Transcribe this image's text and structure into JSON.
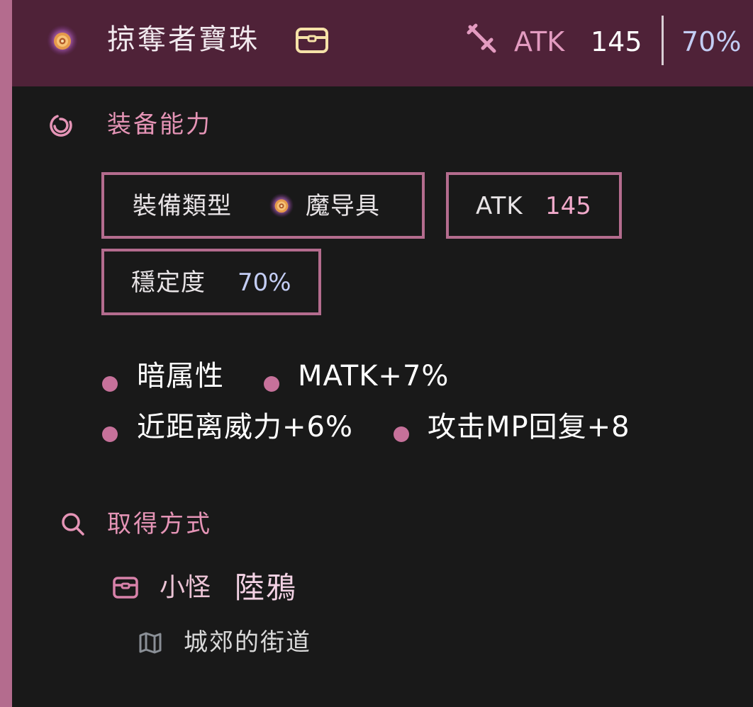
{
  "header": {
    "item_name": "掠奪者寶珠",
    "atk_label": "ATK",
    "atk_value": "145",
    "stability": "70%"
  },
  "equipment_section": {
    "title": "装备能力",
    "type_label": "裝備類型",
    "type_value": "魔导具",
    "atk_label": "ATK",
    "atk_value": "145",
    "stability_label": "穩定度",
    "stability_value": "70%"
  },
  "abilities": [
    "暗属性",
    "MATK+7%",
    "近距离威力+6%",
    "攻击MP回复+8"
  ],
  "acquisition_section": {
    "title": "取得方式",
    "source_type": "小怪",
    "source_name": "陸鴉",
    "location": "城郊的街道"
  },
  "icons": {
    "item": "magic-orb-icon",
    "drop": "chest-icon",
    "weapon": "sword-icon",
    "equipment_section": "swirl-icon",
    "acquisition_section": "search-icon",
    "location": "map-icon"
  },
  "colors": {
    "header_bg": "#4f2238",
    "panel_bg": "#191919",
    "accent_pink": "#b46c8e",
    "section_title": "#e594b6",
    "value_pink": "#f0a9ca",
    "value_blue": "#c3cdf4",
    "chest_yellow": "#f6e2a8"
  }
}
